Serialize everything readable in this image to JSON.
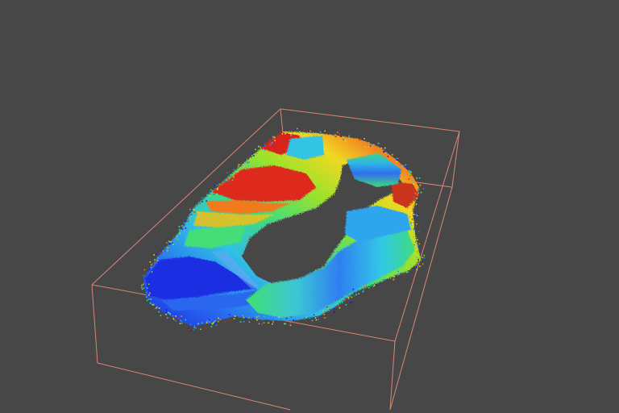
{
  "viewer": {
    "background_color": "#474747",
    "bounding_box_color": "#d9867a",
    "colormap": "jet",
    "colormap_stops": [
      "#1020e0",
      "#2f7ff0",
      "#30c8e8",
      "#40e080",
      "#9be22d",
      "#f0d820",
      "#f08a20",
      "#d82020"
    ]
  }
}
